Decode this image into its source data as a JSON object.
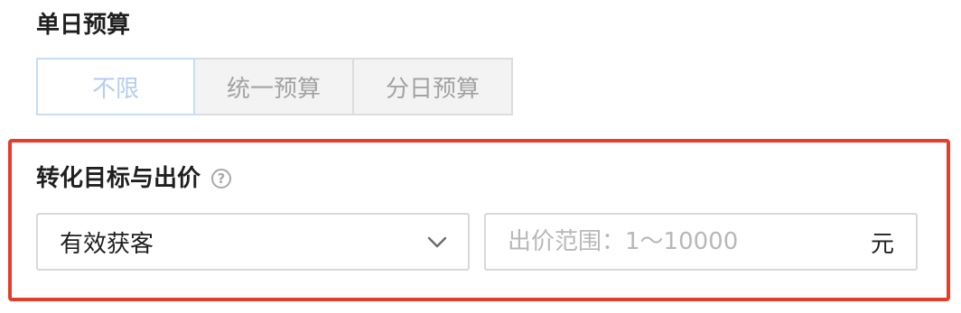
{
  "budget": {
    "title": "单日预算",
    "options": [
      {
        "label": "不限",
        "active": true
      },
      {
        "label": "统一预算",
        "active": false
      },
      {
        "label": "分日预算",
        "active": false
      }
    ]
  },
  "conversion": {
    "title": "转化目标与出价",
    "help_icon": "question-circle-icon",
    "goal_select": {
      "value": "有效获客",
      "icon": "chevron-down-icon"
    },
    "bid_input": {
      "value": "",
      "placeholder": "出价范围：1～10000",
      "unit": "元"
    }
  },
  "colors": {
    "highlight_border": "#e43e2b",
    "active_option_text": "#b5cdef",
    "active_option_border": "#c8dcf6"
  }
}
